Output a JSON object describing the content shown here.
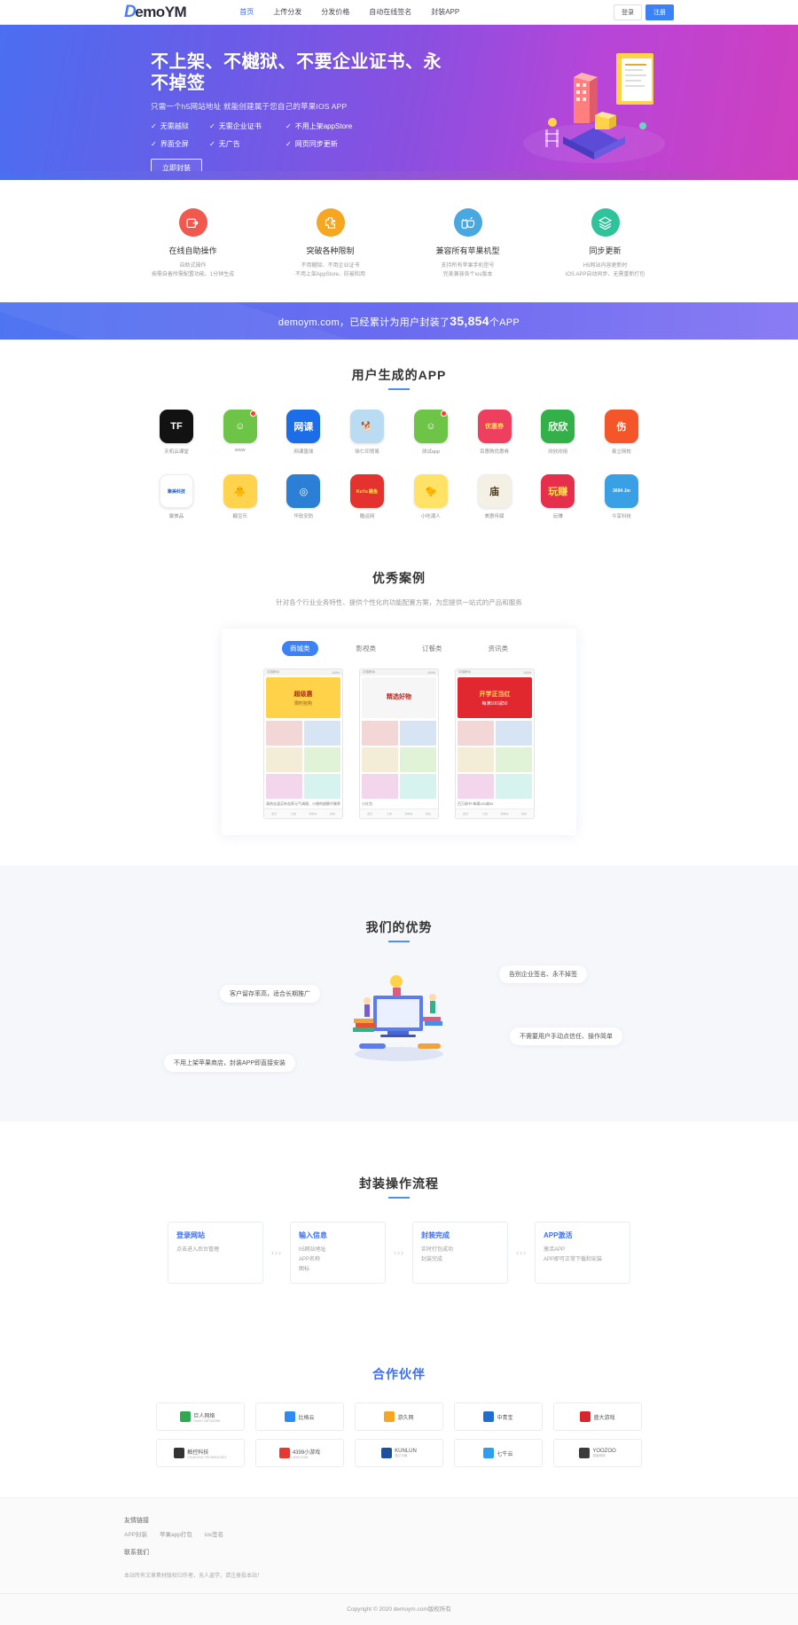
{
  "header": {
    "logo_d": "D",
    "logo_rest": "emoYM",
    "nav": [
      {
        "label": "首页",
        "active": true
      },
      {
        "label": "上传分发",
        "active": false
      },
      {
        "label": "分发价格",
        "active": false
      },
      {
        "label": "自动在线签名",
        "active": false
      },
      {
        "label": "封装APP",
        "active": false
      }
    ],
    "login_label": "登录",
    "register_label": "注册"
  },
  "hero": {
    "title": "不上架、不樾狱、不要企业证书、永不掉签",
    "subtitle": "只需一个h5网站地址 就能创建属于您自己的苹果IOS APP",
    "features_row1": [
      "无需越狱",
      "无需企业证书",
      "不用上架appStore"
    ],
    "features_row2": [
      "界面全屏",
      "无广告",
      "网页同步更新"
    ],
    "check_glyph": "✓",
    "cta_label": "立即封装"
  },
  "features": [
    {
      "title": "在线自助操作",
      "desc": "自助式操作\n按需自备所需配置功能、1分钟生成",
      "icon": "wallet-arrow-icon",
      "color": "#f1584e"
    },
    {
      "title": "突破各种限制",
      "desc": "不用樾狱、不用企业证书\n不用上架AppStore、防被和用",
      "icon": "puzzle-icon",
      "color": "#f5a623"
    },
    {
      "title": "兼容所有苹果机型",
      "desc": "支持所有苹果手机型号\n完美兼容各个ios版本",
      "icon": "android-apple-icon",
      "color": "#4aa8e0"
    },
    {
      "title": "同步更新",
      "desc": "H5网站内容更新时\nIOS APP自动同步、无需重新打包",
      "icon": "layers-icon",
      "color": "#2fc39b"
    }
  ],
  "stat_bar": {
    "prefix": "demoym.com，已经累计为用户封装了",
    "count": "35,854",
    "suffix": "个APP"
  },
  "apps_section": {
    "title": "用户生成的APP",
    "rows": [
      [
        {
          "label": "天机云课堂",
          "glyph": "TF",
          "bg": "#121212",
          "fg": "#ffffff",
          "badge": false
        },
        {
          "label": "www",
          "glyph": "☺",
          "bg": "#6dc446",
          "fg": "#ffffff",
          "badge": true
        },
        {
          "label": "网课篮球",
          "glyph": "网课",
          "bg": "#1c6ee8",
          "fg": "#ffffff",
          "badge": false
        },
        {
          "label": "徐仁印贸易",
          "glyph": "🐕",
          "bg": "#b9dcf2",
          "fg": "#1c1c1c",
          "badge": false
        },
        {
          "label": "测试app",
          "glyph": "☺",
          "bg": "#6dc446",
          "fg": "#ffffff",
          "badge": true
        },
        {
          "label": "百惠购优惠券",
          "glyph": "优惠券",
          "bg": "#ef3f5e",
          "fg": "#ffe34d",
          "badge": false
        },
        {
          "label": "欣欣欣用",
          "glyph": "欣欣",
          "bg": "#34b049",
          "fg": "#ffffff",
          "badge": false
        },
        {
          "label": "易立网校",
          "glyph": "伤",
          "bg": "#f4562a",
          "fg": "#ffffff",
          "badge": false
        }
      ],
      [
        {
          "label": "聚美品",
          "glyph": "聚美科技",
          "bg": "#ffffff",
          "fg": "#2a5fb8",
          "badge": false
        },
        {
          "label": "糠豆乐",
          "glyph": "🐥",
          "bg": "#ffd34e",
          "fg": "#333333",
          "badge": false
        },
        {
          "label": "华软安防",
          "glyph": "◎",
          "bg": "#2b7fd4",
          "fg": "#ffffff",
          "badge": false
        },
        {
          "label": "酷运网",
          "glyph": "KuYu 酷鱼",
          "bg": "#e4322f",
          "fg": "#ffe14d",
          "badge": false
        },
        {
          "label": "小吃潮人",
          "glyph": "🐤",
          "bg": "#ffe266",
          "fg": "#333333",
          "badge": false
        },
        {
          "label": "美惠传媒",
          "glyph": "庙",
          "bg": "#f4f0e4",
          "fg": "#4a3b22",
          "badge": false
        },
        {
          "label": "玩赚",
          "glyph": "玩赚",
          "bg": "#e62e4d",
          "fg": "#ffe14d",
          "badge": false
        },
        {
          "label": "今享科技",
          "glyph": "3694 Jin",
          "bg": "#3aa0e6",
          "fg": "#ffffff",
          "badge": false
        }
      ]
    ]
  },
  "cases_section": {
    "title": "优秀案例",
    "subtitle": "针对各个行业业务特性、提供个性化的功能配置方案，为您提供一站式的产品和服务",
    "tabs": [
      {
        "label": "商城类",
        "active": true
      },
      {
        "label": "影视类",
        "active": false
      },
      {
        "label": "订餐类",
        "active": false
      },
      {
        "label": "资讯类",
        "active": false
      }
    ],
    "phones": [
      {
        "status_left": "中国移动",
        "status_right": "100%",
        "banner_title": "超级惠",
        "banner_sub": "限时抢购",
        "card_text": "清热去湿买补血养元气调理、小便的甜蜜代餐养生茶",
        "nav": [
          "首页",
          "分类",
          "购物车",
          "我的"
        ],
        "bg": "#ffd24a"
      },
      {
        "status_left": "中国移动",
        "status_right": "100%",
        "banner_title": "精选好物",
        "banner_sub": "",
        "card_text": "小红包",
        "nav": [
          "首页",
          "分类",
          "购物车",
          "我的"
        ],
        "bg": "#f6f6f6"
      },
      {
        "status_left": "中国移动",
        "status_right": "100%",
        "banner_title": "开学正当红",
        "banner_sub": "每满100减50",
        "card_text": "百万册书 每满100减50",
        "nav": [
          "首页",
          "分类",
          "购物车",
          "我的"
        ],
        "bg": "#e1272f"
      }
    ]
  },
  "advantage_section": {
    "title": "我们的优势",
    "bubbles": [
      "客户留存率高，适合长期推广",
      "告别企业签名、永不掉签",
      "不用上架苹果商店，封装APP即直接安装",
      "不需要用户手动点信任、操作简单"
    ]
  },
  "process_section": {
    "title": "封装操作流程",
    "arrow_glyph": "›››",
    "steps": [
      {
        "title": "登录网站",
        "desc": "点击进入后台管理"
      },
      {
        "title": "输入信息",
        "desc": "h5网站地址\nAPP名称\n图标"
      },
      {
        "title": "封装完成",
        "desc": "实时打包成功\n封装完成"
      },
      {
        "title": "APP激活",
        "desc": "激活APP\nAPP即可正常下载和安装"
      }
    ]
  },
  "partners_section": {
    "title": "合作伙伴",
    "items": [
      {
        "name": "巨人网络",
        "sub": "GIANT NETWORK",
        "color": "#2fa84f"
      },
      {
        "name": "比格云",
        "sub": "",
        "color": "#2e8bef"
      },
      {
        "name": "游久网",
        "sub": "",
        "color": "#f5a623"
      },
      {
        "name": "中青宝",
        "sub": "",
        "color": "#1f6fd0"
      },
      {
        "name": "盛大游戏",
        "sub": "",
        "color": "#d8272c"
      },
      {
        "name": "触控科技",
        "sub": "CHUKONG TECHNOLOGY",
        "color": "#333333"
      },
      {
        "name": "4399小游戏",
        "sub": "4399.COM",
        "color": "#e8372f"
      },
      {
        "name": "KUNLUN",
        "sub": "昆仑万维",
        "color": "#1c4f9c"
      },
      {
        "name": "七牛云",
        "sub": "",
        "color": "#2e9ff0"
      },
      {
        "name": "YOOZOO",
        "sub": "游族网络",
        "color": "#3a3a3a"
      }
    ]
  },
  "footer": {
    "groups": [
      {
        "heading": "友情链接",
        "links": [
          "APP封装",
          "苹果app打包",
          "ios签名"
        ]
      },
      {
        "heading": "联系我们",
        "links": []
      }
    ],
    "note": "本站所有文章素材版权归作者，无人盗学，请注册投本站！",
    "copyright": "Copyright © 2020 demoym.com版权所有"
  }
}
